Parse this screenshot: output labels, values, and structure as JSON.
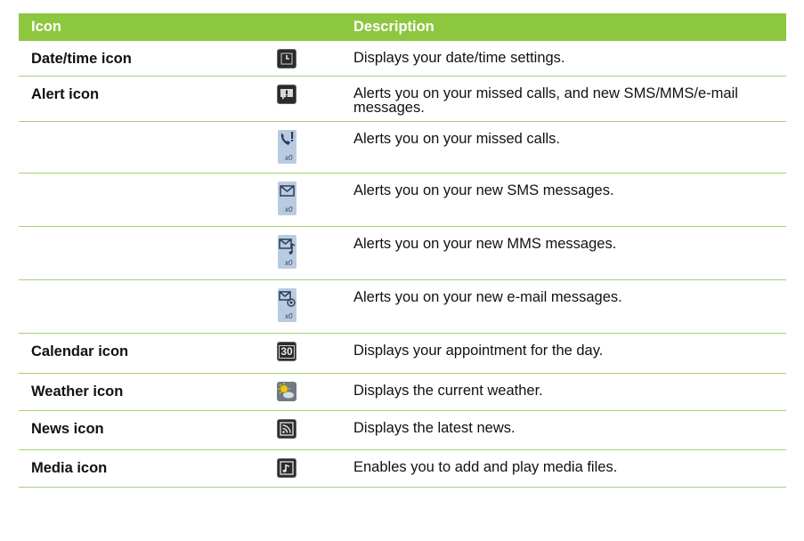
{
  "header": {
    "icon": "Icon",
    "description": "Description"
  },
  "rows": [
    {
      "name": "Date/time icon",
      "icon": "clock-icon",
      "description": "Displays your date/time settings."
    },
    {
      "name": "Alert icon",
      "icon": "alert-icon",
      "description": "Alerts you on your missed calls, and new SMS/MMS/e-mail messages."
    },
    {
      "name": "",
      "icon": "missed-call-icon",
      "badge": "x0",
      "description": "Alerts you on your missed calls."
    },
    {
      "name": "",
      "icon": "sms-icon",
      "badge": "x0",
      "description": "Alerts you on your new SMS messages."
    },
    {
      "name": "",
      "icon": "mms-icon",
      "badge": "x0",
      "description": "Alerts you on your new MMS messages."
    },
    {
      "name": "",
      "icon": "email-icon",
      "badge": "x0",
      "description": "Alerts you on your new e-mail messages."
    },
    {
      "name": "Calendar icon",
      "icon": "calendar-icon",
      "icon_text": "30",
      "description": "Displays your appointment for the day."
    },
    {
      "name": "Weather icon",
      "icon": "weather-icon",
      "description": "Displays the current weather."
    },
    {
      "name": "News icon",
      "icon": "rss-icon",
      "description": "Displays the latest news."
    },
    {
      "name": "Media icon",
      "icon": "media-icon",
      "description": "Enables you to add and play media files."
    }
  ],
  "colors": {
    "header_bg": "#8dc63f",
    "row_border": "#a3d36a"
  }
}
